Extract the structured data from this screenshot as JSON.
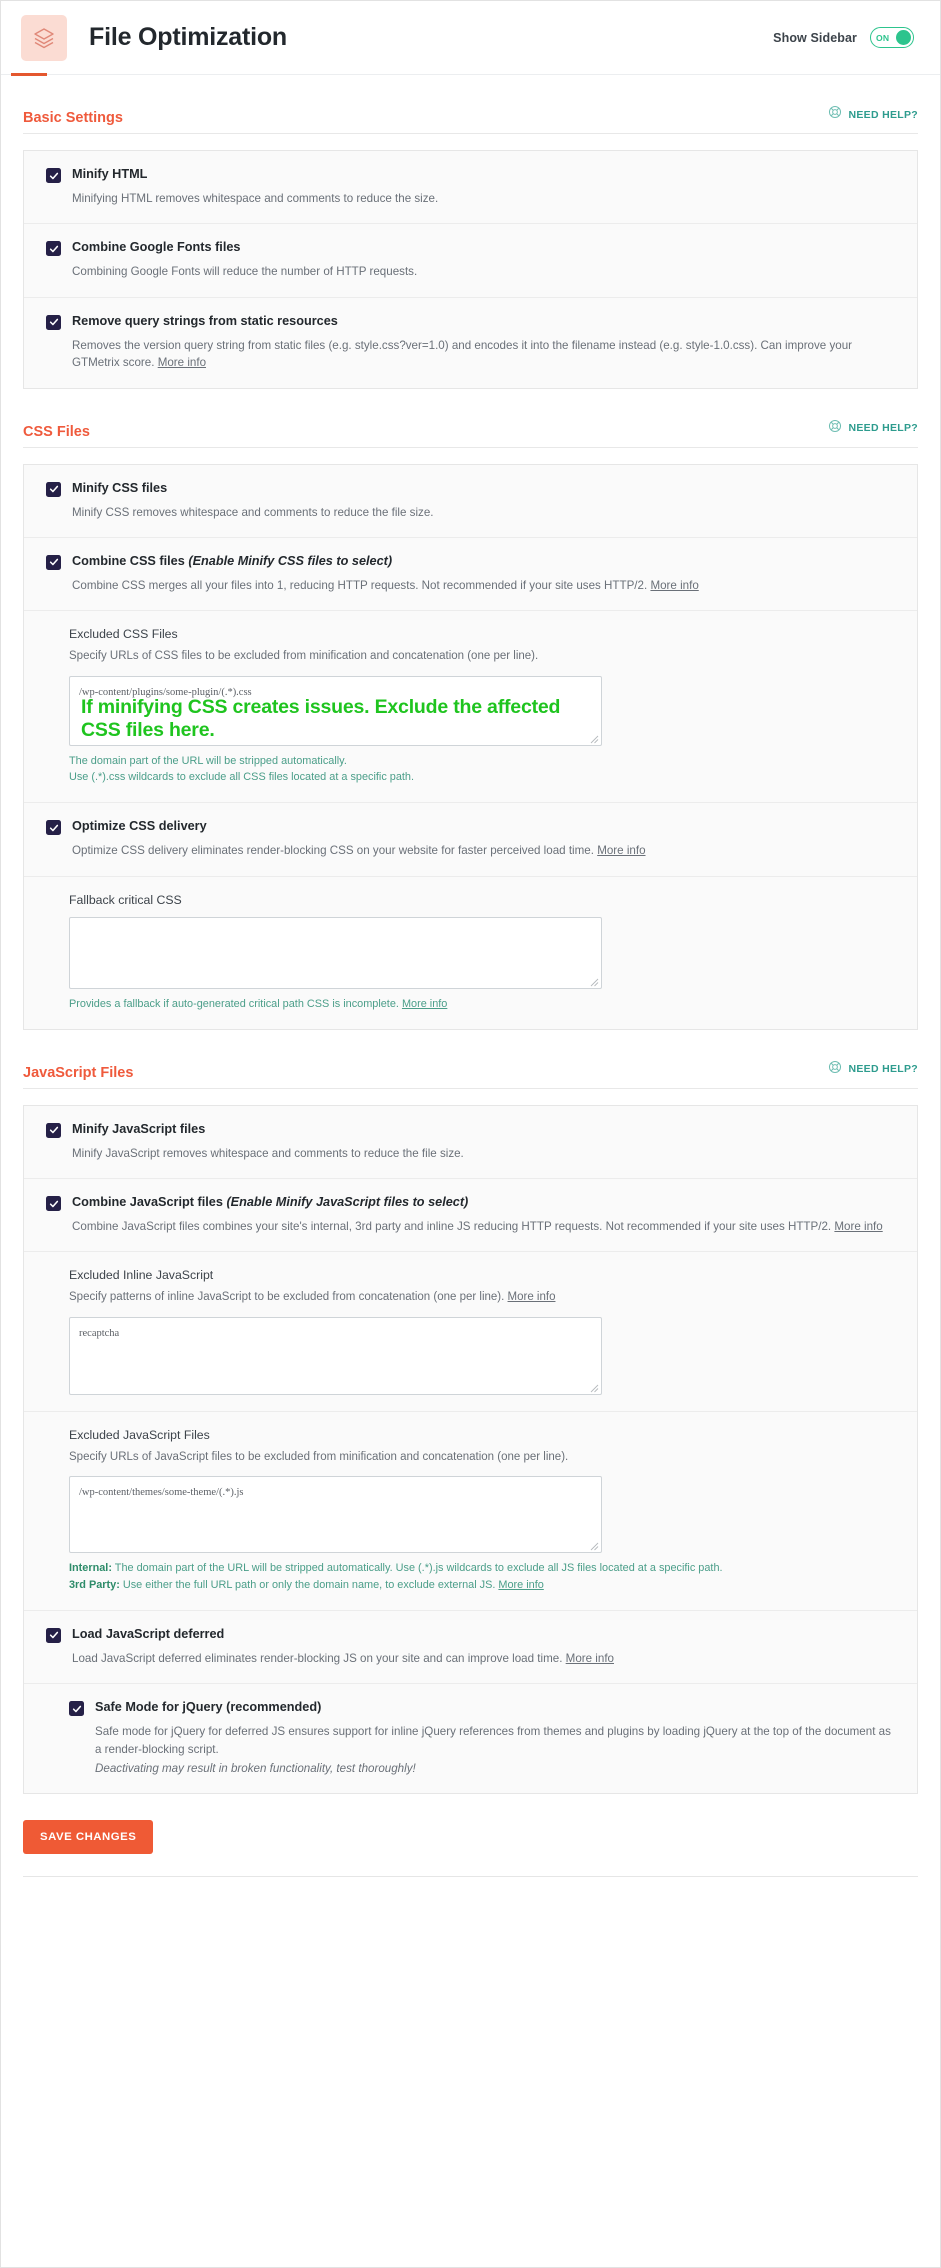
{
  "header": {
    "title": "File Optimization",
    "icon": "layers-icon",
    "sidebar_label": "Show Sidebar",
    "toggle_state": "ON",
    "accent_color": "#e4572e",
    "toggle_color": "#2dc48d"
  },
  "need_help_label": "NEED HELP?",
  "sections": {
    "basic": {
      "title": "Basic Settings",
      "items": [
        {
          "label": "Minify HTML",
          "checked": true,
          "desc": "Minifying HTML removes whitespace and comments to reduce the size."
        },
        {
          "label": "Combine Google Fonts files",
          "checked": true,
          "desc": "Combining Google Fonts will reduce the number of HTTP requests."
        },
        {
          "label": "Remove query strings from static resources",
          "checked": true,
          "desc": "Removes the version query string from static files (e.g. style.css?ver=1.0) and encodes it into the filename instead (e.g. style-1.0.css). Can improve your GTMetrix score.",
          "link": "More info"
        }
      ]
    },
    "css": {
      "title": "CSS Files",
      "minify": {
        "label": "Minify CSS files",
        "checked": true,
        "desc": "Minify CSS removes whitespace and comments to reduce the file size."
      },
      "combine": {
        "label": "Combine CSS files",
        "label_hint": "(Enable Minify CSS files to select)",
        "checked": true,
        "desc": "Combine CSS merges all your files into 1, reducing HTTP requests. Not recommended if your site uses HTTP/2.",
        "link": "More info"
      },
      "excluded": {
        "label": "Excluded CSS Files",
        "desc": "Specify URLs of CSS files to be excluded from minification and concatenation (one per line).",
        "value": "/wp-content/plugins/some-plugin/(.*).css",
        "annotation": "If minifying CSS creates issues. Exclude the affected CSS files here.",
        "annotation_color": "#1fc41f",
        "note_line1": "The domain part of the URL will be stripped automatically.",
        "note_line2": "Use (.*).css wildcards to exclude all CSS files located at a specific path."
      },
      "optimize": {
        "label": "Optimize CSS delivery",
        "checked": true,
        "desc": "Optimize CSS delivery eliminates render-blocking CSS on your website for faster perceived load time.",
        "link": "More info"
      },
      "fallback": {
        "label": "Fallback critical CSS",
        "value": "",
        "note": "Provides a fallback if auto-generated critical path CSS is incomplete.",
        "note_link": "More info"
      }
    },
    "js": {
      "title": "JavaScript Files",
      "minify": {
        "label": "Minify JavaScript files",
        "checked": true,
        "desc": "Minify JavaScript removes whitespace and comments to reduce the file size."
      },
      "combine": {
        "label": "Combine JavaScript files",
        "label_hint": "(Enable Minify JavaScript files to select)",
        "checked": true,
        "desc": "Combine JavaScript files combines your site's internal, 3rd party and inline JS reducing HTTP requests. Not recommended if your site uses HTTP/2.",
        "link": "More info"
      },
      "excluded_inline": {
        "label": "Excluded Inline JavaScript",
        "desc": "Specify patterns of inline JavaScript to be excluded from concatenation (one per line).",
        "link": "More info",
        "value": "recaptcha"
      },
      "excluded_files": {
        "label": "Excluded JavaScript Files",
        "desc": "Specify URLs of JavaScript files to be excluded from minification and concatenation (one per line).",
        "value": "/wp-content/themes/some-theme/(.*).js",
        "note_internal_label": "Internal:",
        "note_internal": " The domain part of the URL will be stripped automatically. Use (.*).js wildcards to exclude all JS files located at a specific path.",
        "note_3rd_label": "3rd Party:",
        "note_3rd": " Use either the full URL path or only the domain name, to exclude external JS.",
        "note_link": "More info"
      },
      "deferred": {
        "label": "Load JavaScript deferred",
        "checked": true,
        "desc": "Load JavaScript deferred eliminates render-blocking JS on your site and can improve load time.",
        "link": "More info"
      },
      "safe_mode": {
        "label": "Safe Mode for jQuery (recommended)",
        "checked": true,
        "desc": "Safe mode for jQuery for deferred JS ensures support for inline jQuery references from themes and plugins by loading jQuery at the top of the document as a render-blocking script.",
        "italic_note": "Deactivating may result in broken functionality, test thoroughly!"
      }
    }
  },
  "save_button": "SAVE CHANGES"
}
